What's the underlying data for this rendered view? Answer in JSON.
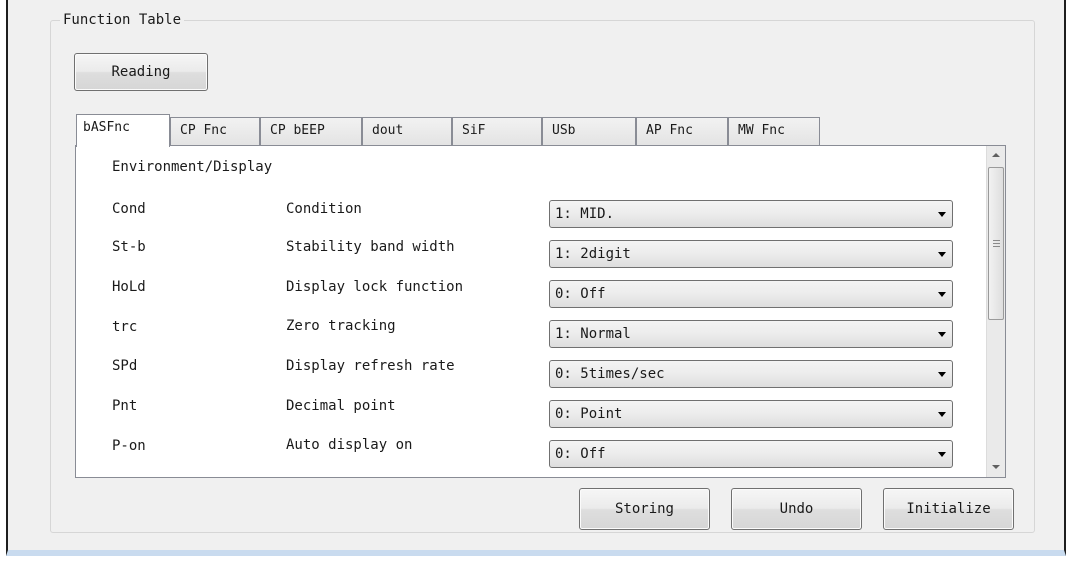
{
  "group_title": "Function Table",
  "buttons": {
    "reading": "Reading",
    "storing": "Storing",
    "undo": "Undo",
    "initialize": "Initialize"
  },
  "tabs": [
    "bASFnc",
    "CP Fnc",
    "CP bEEP",
    "dout",
    "SiF",
    "USb",
    "AP Fnc",
    "MW Fnc"
  ],
  "active_tab": "bASFnc",
  "section_heading": "Environment/Display",
  "rows": [
    {
      "code": "Cond",
      "description": "Condition",
      "value": "1: MID."
    },
    {
      "code": "St-b",
      "description": "Stability band width",
      "value": "1: 2digit"
    },
    {
      "code": "HoLd",
      "description": "Display lock function",
      "value": "0: Off"
    },
    {
      "code": "trc",
      "description": "Zero tracking",
      "value": "1: Normal"
    },
    {
      "code": "SPd",
      "description": "Display refresh rate",
      "value": "0: 5times/sec"
    },
    {
      "code": "Pnt",
      "description": "Decimal point",
      "value": "0: Point"
    },
    {
      "code": "P-on",
      "description": "Auto display on",
      "value": "0: Off"
    }
  ],
  "icons": {
    "dropdown": "chevron-down-icon",
    "scroll_up": "scroll-up-arrow-icon",
    "scroll_down": "scroll-down-arrow-icon"
  }
}
